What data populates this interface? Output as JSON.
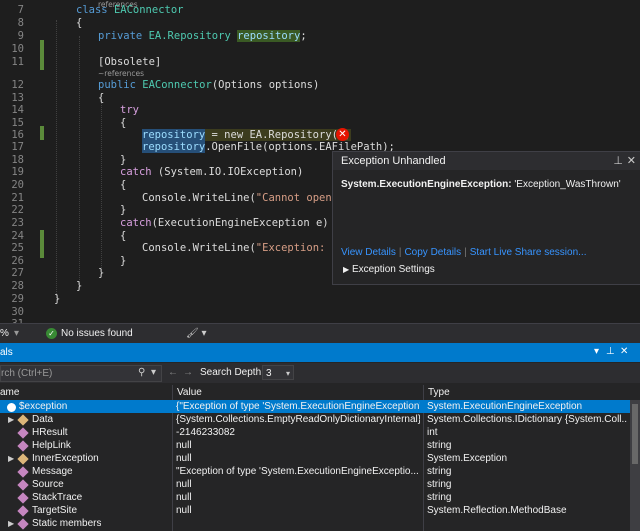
{
  "editor": {
    "line_numbers": [
      "7",
      "8",
      "9",
      "10",
      "11",
      "12",
      "13",
      "14",
      "15",
      "16",
      "17",
      "18",
      "19",
      "20",
      "21",
      "22",
      "23",
      "24",
      "25",
      "26",
      "27",
      "28",
      "29",
      "30",
      "31"
    ],
    "refs_label": "references",
    "refs_label2": "~references",
    "lines": {
      "l7_kw": "class",
      "l7_name": "EAConnector",
      "l8": "{",
      "l9_kw": "private",
      "l9_type": "EA.Repository",
      "l9_field": "repository",
      "l9_end": ";",
      "l11": "[Obsolete]",
      "l12_kw": "public",
      "l12_name": "EAConnector",
      "l12_args": "(Options options)",
      "l13": "{",
      "l14": "try",
      "l15": "{",
      "l16_field": "repository",
      "l16_rest": " = new EA.Repository();",
      "l17_field": "repository",
      "l17_rest": ".OpenFile(options.EAFilePath);",
      "l18": "}",
      "l19_kw": "catch",
      "l19_rest": " (System.IO.IOException)",
      "l20": "{",
      "l21_pre": "Console.WriteLine(",
      "l21_str": "\"Cannot open fil",
      "l22": "}",
      "l23_kw": "catch",
      "l23_rest": "(ExecutionEngineException e)",
      "l24": "{",
      "l25_pre": "Console.WriteLine(",
      "l25_str": "\"Exception: \" +",
      "l26": "}",
      "l27": "}",
      "l28": "}",
      "l29": "}"
    }
  },
  "exception_popup": {
    "title": "Exception Unhandled",
    "type": "System.ExecutionEngineException:",
    "message": "'Exception_WasThrown'",
    "links": [
      "View Details",
      "Copy Details",
      "Start Live Share session..."
    ],
    "settings": "Exception Settings"
  },
  "status": {
    "zoom": "%",
    "issues": "No issues found"
  },
  "locals": {
    "title": "als",
    "search_placeholder": "rch (Ctrl+E)",
    "depth_label": "Search Depth:",
    "depth_value": "3",
    "columns": [
      "ame",
      "Value",
      "Type"
    ],
    "rows": [
      {
        "name": "$exception",
        "value": "{\"Exception of type 'System.ExecutionEngineException' w...",
        "type": "System.ExecutionEngineException"
      },
      {
        "name": "Data",
        "value": "{System.Collections.EmptyReadOnlyDictionaryInternal}",
        "type": "System.Collections.IDictionary {System.Coll..."
      },
      {
        "name": "HResult",
        "value": "-2146233082",
        "type": "int"
      },
      {
        "name": "HelpLink",
        "value": "null",
        "type": "string"
      },
      {
        "name": "InnerException",
        "value": "null",
        "type": "System.Exception"
      },
      {
        "name": "Message",
        "value": "\"Exception of type 'System.ExecutionEngineExceptio...",
        "type": "string"
      },
      {
        "name": "Source",
        "value": "null",
        "type": "string"
      },
      {
        "name": "StackTrace",
        "value": "null",
        "type": "string"
      },
      {
        "name": "TargetSite",
        "value": "null",
        "type": "System.Reflection.MethodBase"
      },
      {
        "name": "Static members",
        "value": "",
        "type": ""
      }
    ]
  }
}
